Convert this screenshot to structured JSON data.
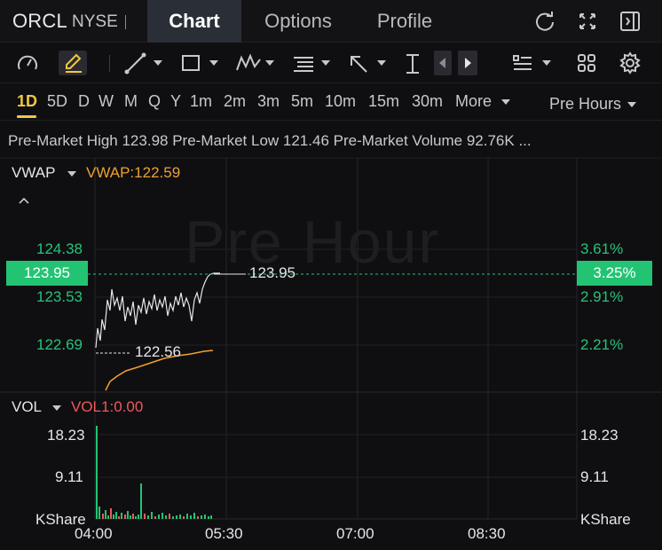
{
  "header": {
    "symbol": "ORCL",
    "exchange": "NYSE",
    "tabs": [
      {
        "label": "Chart",
        "active": true
      },
      {
        "label": "Options",
        "active": false
      },
      {
        "label": "Profile",
        "active": false
      }
    ],
    "icons": [
      "refresh-icon",
      "expand-icon",
      "collapse-panel-icon"
    ]
  },
  "toolbar": {
    "icons": [
      "speedometer-icon",
      "draw-pen-icon",
      "trendline-icon",
      "rectangle-icon",
      "wave-pattern-icon",
      "fibonacci-icon",
      "arrow-icon",
      "vertical-line-icon",
      "prev-icon",
      "next-icon",
      "list-icon",
      "grid-icon",
      "gear-icon"
    ]
  },
  "periods": {
    "items": [
      "1D",
      "5D",
      "D",
      "W",
      "M",
      "Q",
      "Y",
      "1m",
      "2m",
      "3m",
      "5m",
      "10m",
      "15m",
      "30m",
      "More"
    ],
    "active": "1D",
    "session": "Pre Hours"
  },
  "info": {
    "text": "Pre-Market High 123.98 Pre-Market Low 121.46 Pre-Market Volume 92.76K ..."
  },
  "main_chart": {
    "indicator_name": "VWAP",
    "indicator_value": "VWAP:122.59",
    "watermark": "Pre Hour",
    "left_axis": [
      "124.38",
      "123.95",
      "123.53",
      "122.69"
    ],
    "right_axis": [
      "3.61%",
      "3.25%",
      "2.91%",
      "2.21%"
    ],
    "current_price": "123.95",
    "current_pct": "3.25%",
    "high_label": "123.95",
    "low_label": "122.56"
  },
  "volume_chart": {
    "indicator_name": "VOL",
    "indicator_value": "VOL1:0.00",
    "left_axis": [
      "18.23",
      "9.11",
      "KShare"
    ],
    "right_axis": [
      "18.23",
      "9.11",
      "KShare"
    ]
  },
  "time_axis": [
    "04:00",
    "05:30",
    "07:00",
    "08:30"
  ],
  "colors": {
    "accent": "#f2c744",
    "up": "#22c473",
    "down": "#f0585a",
    "vwap": "#f0a030",
    "active_tab_bg": "#2a2e37"
  }
}
